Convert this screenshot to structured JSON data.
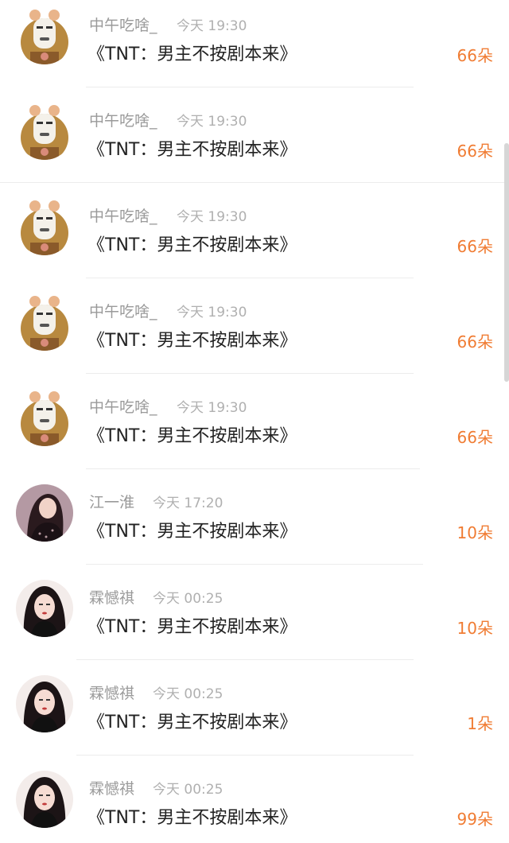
{
  "gift_list": {
    "items": [
      {
        "user_name": "中午吃啥_",
        "time": "今天 19:30",
        "work_title": "《TNT：男主不按剧本来》",
        "amount": "66朵",
        "avatar_icon": "meme-face-avatar"
      },
      {
        "user_name": "中午吃啥_",
        "time": "今天 19:30",
        "work_title": "《TNT：男主不按剧本来》",
        "amount": "66朵",
        "avatar_icon": "meme-face-avatar"
      },
      {
        "user_name": "中午吃啥_",
        "time": "今天 19:30",
        "work_title": "《TNT：男主不按剧本来》",
        "amount": "66朵",
        "avatar_icon": "meme-face-avatar"
      },
      {
        "user_name": "中午吃啥_",
        "time": "今天 19:30",
        "work_title": "《TNT：男主不按剧本来》",
        "amount": "66朵",
        "avatar_icon": "meme-face-avatar"
      },
      {
        "user_name": "中午吃啥_",
        "time": "今天 19:30",
        "work_title": "《TNT：男主不按剧本来》",
        "amount": "66朵",
        "avatar_icon": "meme-face-avatar"
      },
      {
        "user_name": "江一淮",
        "time": "今天 17:20",
        "work_title": "《TNT：男主不按剧本来》",
        "amount": "10朵",
        "avatar_icon": "girl-photo-avatar"
      },
      {
        "user_name": "霖憾祺",
        "time": "今天 00:25",
        "work_title": "《TNT：男主不按剧本来》",
        "amount": "10朵",
        "avatar_icon": "girl-portrait-avatar"
      },
      {
        "user_name": "霖憾祺",
        "time": "今天 00:25",
        "work_title": "《TNT：男主不按剧本来》",
        "amount": "1朵",
        "avatar_icon": "girl-portrait-avatar"
      },
      {
        "user_name": "霖憾祺",
        "time": "今天 00:25",
        "work_title": "《TNT：男主不按剧本来》",
        "amount": "99朵",
        "avatar_icon": "girl-portrait-avatar"
      }
    ]
  },
  "colors": {
    "amount": "#f07c33",
    "name": "#9a9a9a",
    "time": "#b0b0b0",
    "title": "#222222",
    "divider": "#ececec"
  }
}
